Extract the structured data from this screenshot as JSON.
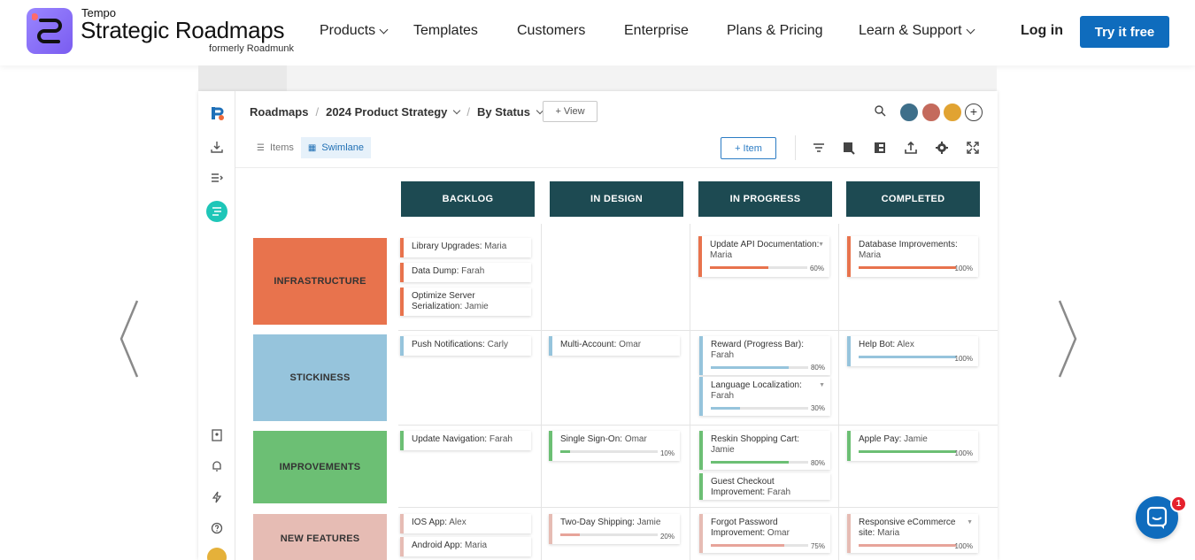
{
  "brand": {
    "company": "Tempo",
    "product": "Strategic Roadmaps",
    "formerly": "formerly Roadmunk"
  },
  "nav": {
    "items": [
      "Products",
      "Templates",
      "Customers",
      "Enterprise",
      "Plans & Pricing",
      "Learn & Support"
    ],
    "login": "Log in",
    "cta": "Try it free"
  },
  "app": {
    "breadcrumb": {
      "root": "Roadmaps",
      "roadmap": "2024 Product Strategy",
      "view": "By Status"
    },
    "view_button": "+ View",
    "tabs": {
      "items": "Items",
      "swimlane": "Swimlane"
    },
    "item_button": "+ Item",
    "columns": [
      "BACKLOG",
      "IN DESIGN",
      "IN PROGRESS",
      "COMPLETED"
    ],
    "rows": [
      {
        "label": "INFRASTRUCTURE",
        "color": "#e8734d"
      },
      {
        "label": "STICKINESS",
        "color": "#96c4dc"
      },
      {
        "label": "IMPROVEMENTS",
        "color": "#6cbf74"
      },
      {
        "label": "NEW FEATURES",
        "color": "#e6bcb4"
      }
    ],
    "cards": {
      "c1": {
        "title": "Library Upgrades:",
        "who": "Maria"
      },
      "c2": {
        "title": "Data Dump:",
        "who": "Farah"
      },
      "c3": {
        "title": "Optimize Server Serialization:",
        "who": "Jamie"
      },
      "c4": {
        "title": "Update API Documentation:",
        "who": "Maria",
        "pct": "60%"
      },
      "c5": {
        "title": "Database Improvements:",
        "who": "Maria",
        "pct": "100%"
      },
      "c6": {
        "title": "Push Notifications:",
        "who": "Carly"
      },
      "c7": {
        "title": "Multi-Account:",
        "who": "Omar"
      },
      "c8": {
        "title": "Reward (Progress Bar):",
        "who": "Farah",
        "pct": "80%"
      },
      "c9": {
        "title": "Language Localization:",
        "who": "Farah",
        "pct": "30%"
      },
      "c10": {
        "title": "Help Bot:",
        "who": "Alex",
        "pct": "100%"
      },
      "c11": {
        "title": "Update Navigation:",
        "who": "Farah"
      },
      "c12": {
        "title": "Single Sign-On:",
        "who": "Omar",
        "pct": "10%"
      },
      "c13": {
        "title": "Reskin Shopping Cart:",
        "who": "Jamie",
        "pct": "80%"
      },
      "c14": {
        "title": "Guest Checkout Improvement:",
        "who": "Farah"
      },
      "c15": {
        "title": "Apple Pay:",
        "who": "Jamie",
        "pct": "100%"
      },
      "c16": {
        "title": "IOS App:",
        "who": "Alex"
      },
      "c17": {
        "title": "Two-Day Shipping:",
        "who": "Jamie",
        "pct": "20%"
      },
      "c18": {
        "title": "Forgot Password Improvement:",
        "who": "Omar",
        "pct": "75%"
      },
      "c19": {
        "title": "Responsive eCommerce site:",
        "who": "Maria",
        "pct": "100%"
      },
      "c20": {
        "title": "Android App:",
        "who": "Maria"
      }
    }
  },
  "chat": {
    "badge": "1"
  }
}
